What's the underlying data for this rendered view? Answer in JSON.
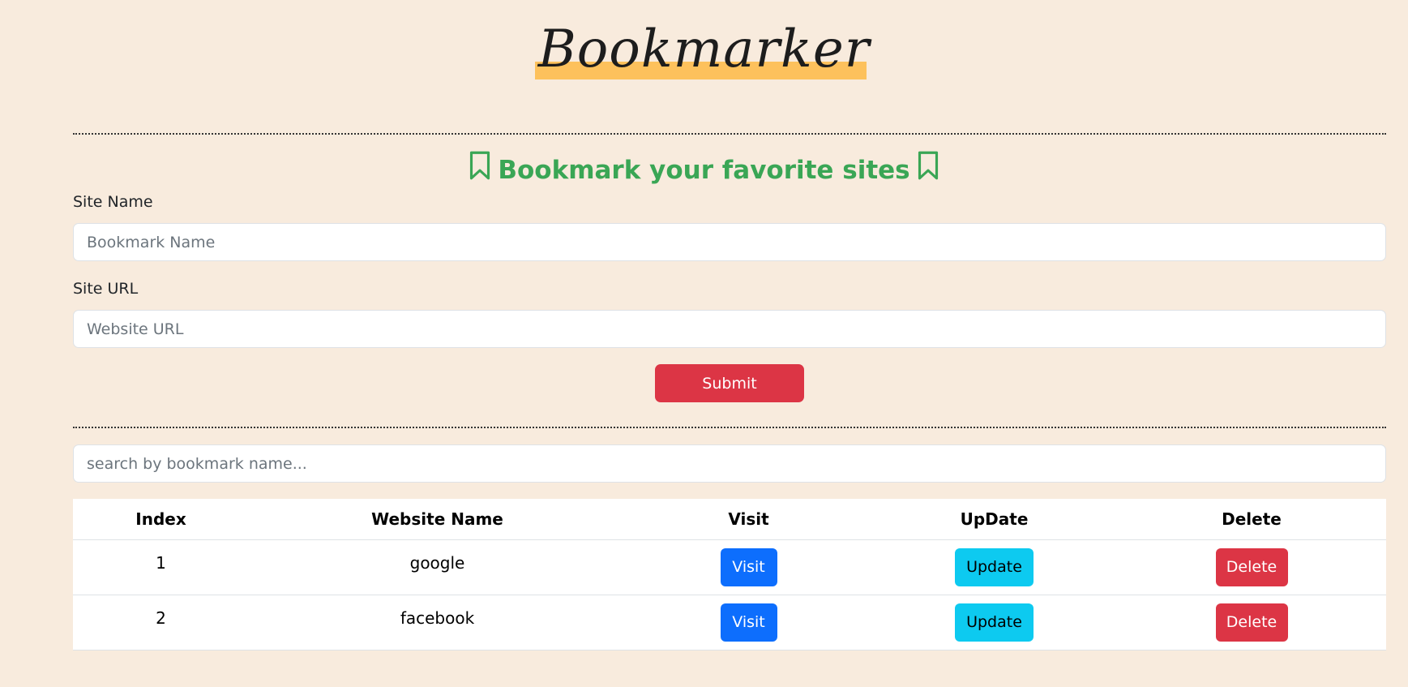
{
  "logo": {
    "text": "Bookmarker"
  },
  "heading": {
    "text": "Bookmark your favorite sites"
  },
  "form": {
    "site_name_label": "Site Name",
    "site_name_placeholder": "Bookmark Name",
    "site_url_label": "Site URL",
    "site_url_placeholder": "Website URL",
    "submit_label": "Submit"
  },
  "search": {
    "placeholder": "search by bookmark name..."
  },
  "table": {
    "headers": [
      "Index",
      "Website Name",
      "Visit",
      "UpDate",
      "Delete"
    ],
    "rows": [
      {
        "index": "1",
        "name": "google",
        "visit": "Visit",
        "update": "Update",
        "delete": "Delete"
      },
      {
        "index": "2",
        "name": "facebook",
        "visit": "Visit",
        "update": "Update",
        "delete": "Delete"
      }
    ]
  },
  "colors": {
    "background": "#f8ebdd",
    "heading_green": "#3aa655",
    "logo_highlight": "#fdc15c",
    "danger": "#dc3545",
    "primary": "#0d6efd",
    "info": "#0dcaf0"
  },
  "icons": {
    "heading_icon": "bookmark-icon"
  }
}
